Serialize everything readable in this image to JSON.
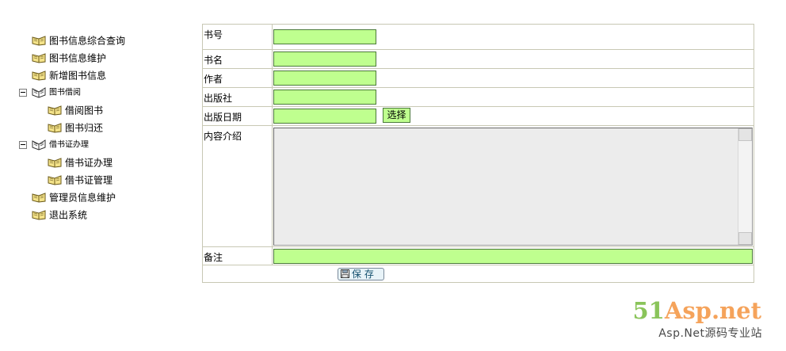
{
  "menu": {
    "items": [
      {
        "label": "图书信息综合查询",
        "level": 0,
        "icon": "book-icon"
      },
      {
        "label": "图书信息维护",
        "level": 0,
        "icon": "book-icon"
      },
      {
        "label": "新增图书信息",
        "level": 0,
        "icon": "book-icon"
      },
      {
        "label": "图书借阅",
        "level": 0,
        "icon": "book-open-icon",
        "group": true,
        "expanded": true
      },
      {
        "label": "借阅图书",
        "level": 1,
        "icon": "book-icon"
      },
      {
        "label": "图书归还",
        "level": 1,
        "icon": "book-icon"
      },
      {
        "label": "借书证办理",
        "level": 0,
        "icon": "book-open-icon",
        "group": true,
        "expanded": true
      },
      {
        "label": "借书证办理",
        "level": 1,
        "icon": "book-icon"
      },
      {
        "label": "借书证管理",
        "level": 1,
        "icon": "book-icon"
      },
      {
        "label": "管理员信息维护",
        "level": 0,
        "icon": "book-icon"
      },
      {
        "label": "退出系统",
        "level": 0,
        "icon": "book-icon"
      }
    ]
  },
  "form": {
    "book_no": {
      "label": "书号",
      "value": ""
    },
    "title": {
      "label": "书名",
      "value": ""
    },
    "author": {
      "label": "作者",
      "value": ""
    },
    "publisher": {
      "label": "出版社",
      "value": ""
    },
    "pub_date": {
      "label": "出版日期",
      "value": "",
      "pick_label": "选择"
    },
    "intro": {
      "label": "内容介绍",
      "value": ""
    },
    "remark": {
      "label": "备注",
      "value": ""
    },
    "save_label": "保 存"
  },
  "watermark": {
    "brand_prefix": "51",
    "brand_rest": "Asp.net",
    "tagline": "Asp.Net源码专业站"
  },
  "colors": {
    "input_bg": "#bfff8f",
    "border": "#c8c8b4",
    "brand_green": "#8ac45a",
    "brand_orange": "#f5a35b"
  }
}
